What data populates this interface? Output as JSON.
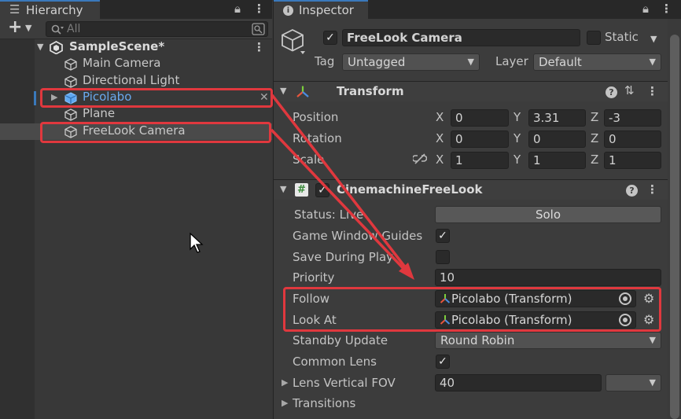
{
  "hierarchy": {
    "tab_title": "Hierarchy",
    "add_label": "+",
    "search_placeholder": "All",
    "scene_name": "SampleScene*",
    "items": [
      {
        "label": "Main Camera"
      },
      {
        "label": "Directional Light"
      },
      {
        "label": "Picolabo"
      },
      {
        "label": "Plane"
      },
      {
        "label": "FreeLook Camera"
      }
    ]
  },
  "inspector": {
    "tab_title": "Inspector",
    "object_name": "FreeLook Camera",
    "static_label": "Static",
    "tag_label": "Tag",
    "tag_value": "Untagged",
    "layer_label": "Layer",
    "layer_value": "Default",
    "transform": {
      "title": "Transform",
      "position_label": "Position",
      "rotation_label": "Rotation",
      "scale_label": "Scale",
      "axis_x": "X",
      "axis_y": "Y",
      "axis_z": "Z",
      "position": {
        "x": "0",
        "y": "3.31",
        "z": "-3"
      },
      "rotation": {
        "x": "0",
        "y": "0",
        "z": "0"
      },
      "scale": {
        "x": "1",
        "y": "1",
        "z": "1"
      }
    },
    "cinemachine": {
      "title": "CinemachineFreeLook",
      "status_label": "Status: Live",
      "solo_label": "Solo",
      "game_window_guides_label": "Game Window Guides",
      "save_during_play_label": "Save During Play",
      "priority_label": "Priority",
      "priority_value": "10",
      "follow_label": "Follow",
      "follow_value": "Picolabo (Transform)",
      "look_at_label": "Look At",
      "look_at_value": "Picolabo (Transform)",
      "standby_update_label": "Standby Update",
      "standby_update_value": "Round Robin",
      "common_lens_label": "Common Lens",
      "lens_fov_label": "Lens Vertical FOV",
      "lens_fov_value": "40",
      "transitions_label": "Transitions"
    }
  },
  "colors": {
    "annotation_red": "#e0383e",
    "selection_blue": "#4c8fe0"
  }
}
